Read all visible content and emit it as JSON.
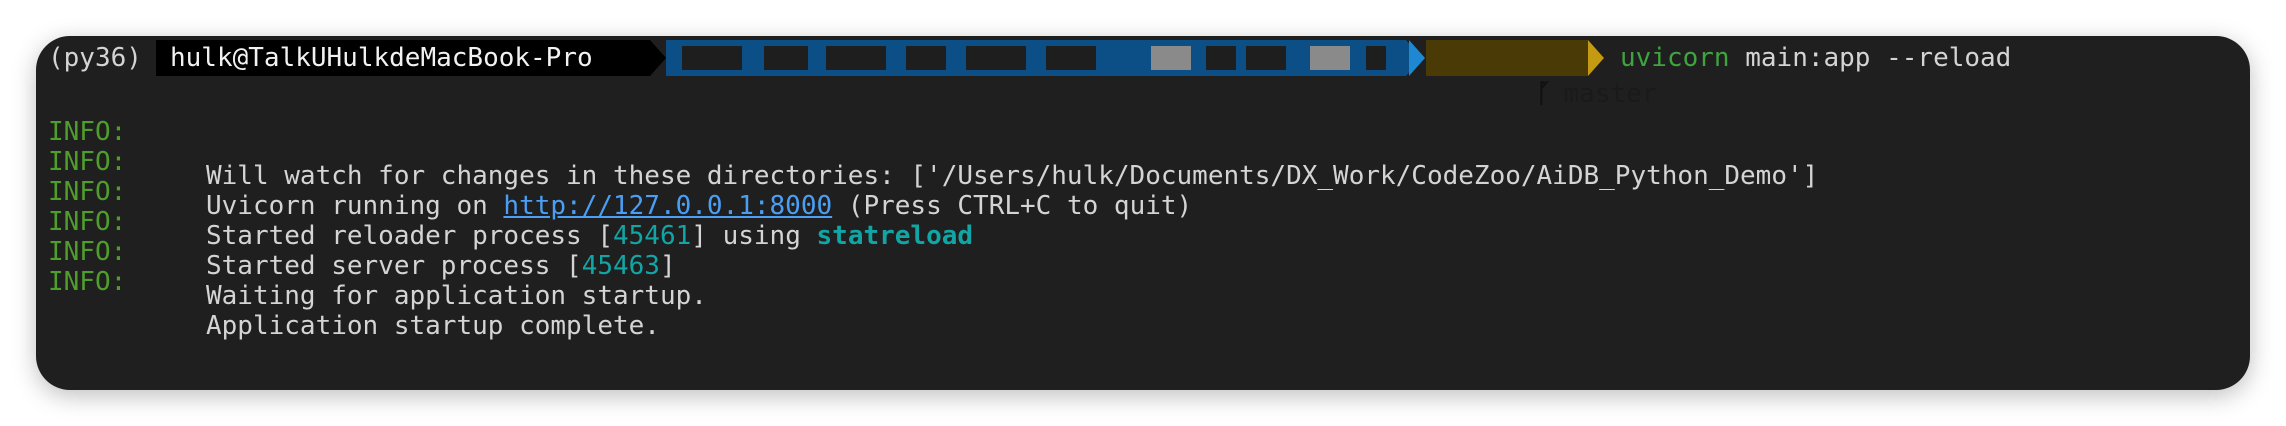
{
  "prompt": {
    "env": "(py36)",
    "user_host": "hulk@TalkUHulkdeMacBook-Pro",
    "branch_icon": "ᚵ",
    "branch": "master",
    "command_program": "uvicorn",
    "command_args": " main:app --reload"
  },
  "log_lines": [
    {
      "level": "INFO:",
      "message": "Will watch for changes in these directories: ['/Users/hulk/Documents/DX_Work/CodeZoo/AiDB_Python_Demo']"
    },
    {
      "level": "INFO:",
      "message_prefix": "Uvicorn running on ",
      "link": "http://127.0.0.1:8000",
      "message_suffix": " (Press CTRL+C to quit)"
    },
    {
      "level": "INFO:",
      "message_prefix": "Started reloader process [",
      "pid": "45461",
      "message_mid": "] using ",
      "keyword": "statreload"
    },
    {
      "level": "INFO:",
      "message_prefix": "Started server process [",
      "pid": "45463",
      "message_suffix": "]"
    },
    {
      "level": "INFO:",
      "message": "Waiting for application startup."
    },
    {
      "level": "INFO:",
      "message": "Application startup complete."
    }
  ],
  "colors": {
    "background": "#1f1f1f",
    "info_level": "#4f9d2a",
    "link": "#4a9ff5",
    "pid": "#12a5a5",
    "path_segment": "#0b4f86",
    "git_segment": "#c49a12"
  }
}
